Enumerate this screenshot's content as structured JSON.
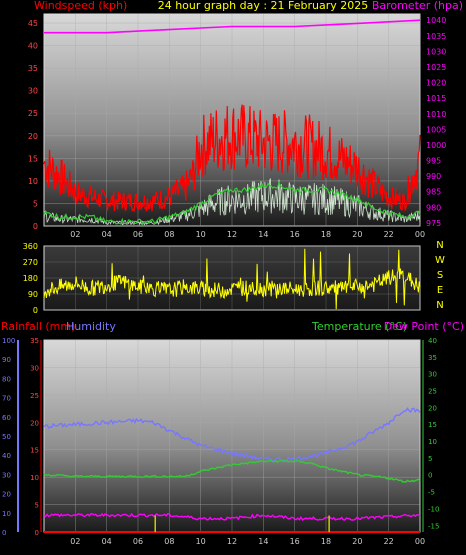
{
  "chart_data": [
    {
      "type": "line",
      "title": "24 hour graph day : 21 February 2025",
      "left_axis_label": "Windspeed (kph)",
      "right_axis_label": "Barometer (hpa)",
      "colors": {
        "wind_gust": "#ff0000",
        "wind_avg": "#33cc33",
        "wind_low": "#e8ffe8",
        "barometer": "#ff00ff"
      },
      "x_ticks": [
        "02",
        "04",
        "06",
        "08",
        "10",
        "12",
        "14",
        "16",
        "18",
        "20",
        "22",
        "00"
      ],
      "y_left_ticks": [
        0,
        5,
        10,
        15,
        20,
        25,
        30,
        35,
        40,
        45
      ],
      "y_left_range": [
        0,
        47
      ],
      "y_right_ticks": [
        975,
        980,
        985,
        990,
        995,
        1000,
        1005,
        1010,
        1015,
        1020,
        1025,
        1030,
        1035,
        1040
      ],
      "y_right_range": [
        974,
        1042
      ],
      "barometer": {
        "x": [
          0,
          2,
          4,
          6,
          8,
          10,
          12,
          14,
          16,
          18,
          20,
          22,
          24
        ],
        "values": [
          1036,
          1036,
          1036,
          1036.5,
          1037,
          1037.5,
          1038,
          1038,
          1038,
          1038.5,
          1039,
          1039.5,
          1040
        ]
      },
      "wind_gust": {
        "x": [
          0,
          1,
          2,
          3,
          4,
          5,
          6,
          7,
          8,
          9,
          9.5,
          10,
          11,
          12,
          13,
          14,
          15,
          16,
          17,
          18,
          19,
          20,
          21,
          22,
          23,
          24
        ],
        "values": [
          15,
          12,
          8,
          7,
          6,
          6,
          6,
          6,
          7,
          9,
          12,
          19,
          21,
          22,
          21,
          20,
          20,
          20,
          19,
          18,
          16,
          14,
          10,
          7,
          6,
          16
        ]
      },
      "wind_avg": {
        "x": [
          0,
          1,
          2,
          3,
          4,
          5,
          6,
          7,
          8,
          9,
          10,
          11,
          12,
          13,
          14,
          15,
          16,
          17,
          18,
          19,
          20,
          21,
          22,
          23,
          24
        ],
        "values": [
          3,
          2,
          2,
          2,
          1,
          1,
          1,
          1,
          2,
          3,
          5,
          7,
          8,
          8,
          9,
          9,
          8,
          8,
          8,
          7,
          6,
          4,
          3,
          2,
          3
        ]
      }
    },
    {
      "type": "scatter",
      "title": "",
      "left_axis_label": "",
      "y_ticks": [
        0,
        90,
        180,
        270,
        360
      ],
      "y_range": [
        0,
        360
      ],
      "compass_labels": [
        "N",
        "W",
        "S",
        "E",
        "N"
      ],
      "color": "#ffff00",
      "wind_direction": {
        "x": [
          0,
          1,
          2,
          3,
          4,
          5,
          6,
          7,
          8,
          9,
          10,
          11,
          12,
          13,
          14,
          15,
          16,
          17,
          18,
          19,
          20,
          21,
          22,
          23,
          24
        ],
        "values": [
          110,
          130,
          150,
          120,
          140,
          160,
          130,
          120,
          110,
          130,
          120,
          110,
          120,
          125,
          120,
          120,
          115,
          120,
          125,
          120,
          130,
          140,
          180,
          200,
          120
        ]
      }
    },
    {
      "type": "line",
      "title": "",
      "left_axis_labels": [
        "Rainfall (mm)",
        "Humidity"
      ],
      "right_axis_labels": [
        "Temperature (°C)",
        "Dew Point (°C)"
      ],
      "colors": {
        "humidity": "#7777ff",
        "temperature": "#33cc33",
        "dewpoint": "#ff00ff",
        "rainfall": "#ff0000",
        "rain_rate": "#cccc00"
      },
      "x_ticks": [
        "02",
        "04",
        "06",
        "08",
        "10",
        "12",
        "14",
        "16",
        "18",
        "20",
        "22",
        "00"
      ],
      "humidity_ticks": [
        0,
        10,
        20,
        30,
        40,
        50,
        60,
        70,
        80,
        90,
        100
      ],
      "humidity_range": [
        0,
        100
      ],
      "rainfall_ticks": [
        0,
        5,
        10,
        15,
        20,
        25,
        30,
        35
      ],
      "rainfall_range": [
        0,
        35
      ],
      "temp_ticks": [
        40,
        35,
        30,
        25,
        20,
        15,
        10,
        5,
        0,
        -5,
        -10,
        -15
      ],
      "temp_range": [
        -17,
        40
      ],
      "humidity": {
        "x": [
          0,
          2,
          4,
          6,
          7,
          8,
          10,
          12,
          14,
          16,
          18,
          20,
          22,
          23,
          24
        ],
        "values": [
          55,
          56,
          57,
          58,
          57,
          53,
          45,
          41,
          38,
          38,
          41,
          47,
          57,
          64,
          63
        ]
      },
      "temperature": {
        "x": [
          0,
          2,
          4,
          6,
          8,
          9,
          10,
          11,
          12,
          13,
          14,
          15,
          16,
          17,
          18,
          19,
          20,
          21,
          22,
          23,
          24
        ],
        "values": [
          0,
          -0.5,
          -0.5,
          -0.5,
          -0.5,
          -0.5,
          1,
          2,
          3,
          3.5,
          4,
          4,
          4,
          3.5,
          2,
          1,
          0,
          -0.5,
          -1,
          -2,
          -1.5
        ]
      },
      "dewpoint": {
        "x": [
          0,
          2,
          4,
          6,
          8,
          10,
          12,
          14,
          16,
          18,
          20,
          22,
          24
        ],
        "values": [
          -12,
          -12,
          -12,
          -12,
          -12,
          -13,
          -13,
          -12,
          -13,
          -13,
          -13,
          -12.5,
          -12
        ]
      },
      "rainfall": {
        "x": [
          0,
          24
        ],
        "values": [
          0,
          0
        ]
      },
      "rain_rate_marks": {
        "x": [
          7.1,
          18.2
        ],
        "values": [
          3,
          3
        ]
      }
    }
  ]
}
